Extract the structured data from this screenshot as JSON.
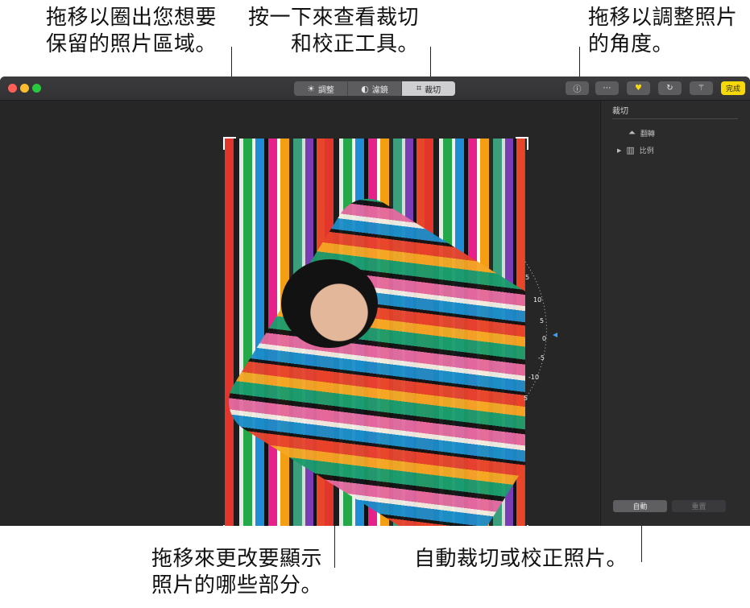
{
  "callouts": {
    "crop_area": "拖移以圈出您想要\n保留的照片區域。",
    "crop_tool": "按一下來查看裁切\n和校正工具。",
    "angle": "拖移以調整照片\n的角度。",
    "visible_part": "拖移來更改要顯示\n照片的哪些部分。",
    "auto": "自動裁切或校正照片。"
  },
  "toolbar": {
    "tabs": [
      {
        "label": "調整",
        "icon": "sun-icon"
      },
      {
        "label": "濾鏡",
        "icon": "filter-circles-icon"
      },
      {
        "label": "裁切",
        "icon": "crop-icon"
      }
    ],
    "active_tab": "裁切",
    "done_label": "完成"
  },
  "sidebar": {
    "title": "裁切",
    "flip_label": "翻轉",
    "ratio_label": "比例",
    "auto_label": "自動",
    "reset_label": "重置"
  },
  "dial": {
    "ticks": [
      "5",
      "10",
      "5",
      "0",
      "-5",
      "-10",
      "5"
    ]
  },
  "colors": {
    "done": "#f5d90a",
    "accent_marker": "#3aa0ff"
  }
}
